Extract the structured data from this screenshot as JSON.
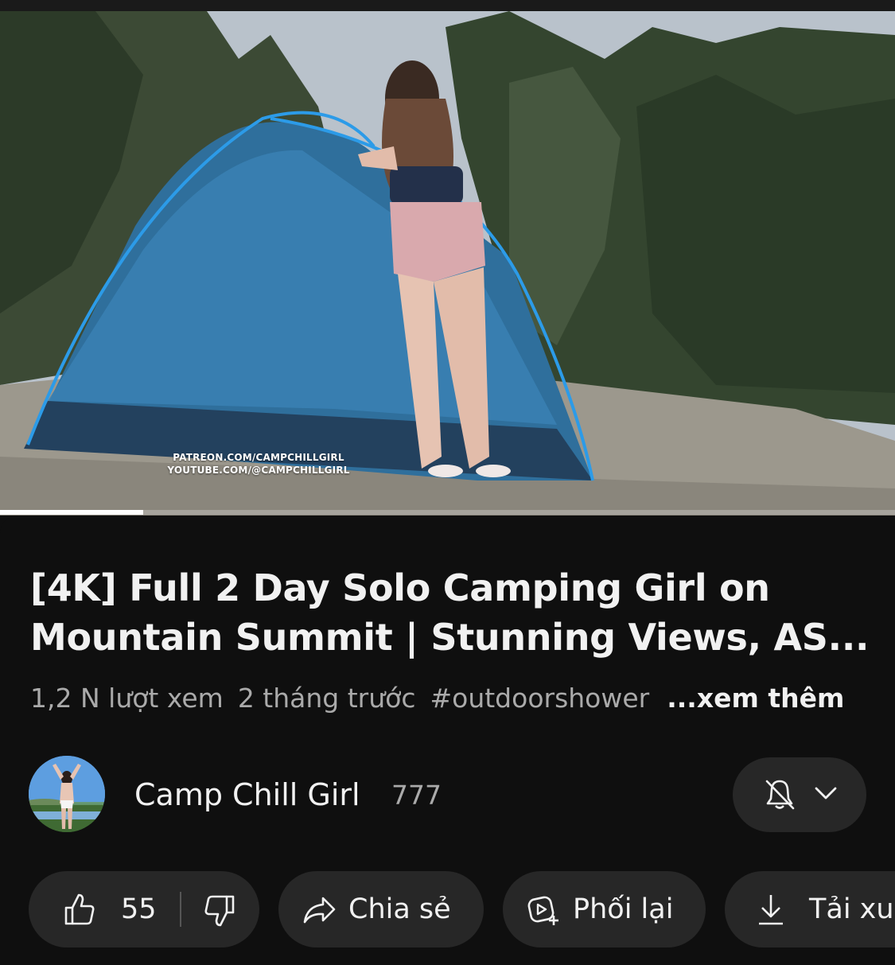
{
  "video": {
    "watermark_line1": "PATREON.COM/CAMPCHILLGIRL",
    "watermark_line2": "YOUTUBE.COM/@CAMPCHILLGIRL",
    "progress_fraction": 0.16
  },
  "title": "[4K] Full 2 Day Solo Camping Girl on Mountain Summit | Stunning Views, AS...",
  "meta": {
    "views": "1,2 N lượt xem",
    "age": "2 tháng trước",
    "hashtag": "#outdoorshower",
    "more": "...xem thêm"
  },
  "channel": {
    "name": "Camp Chill Girl",
    "subscribers": "777",
    "notification_icon": "bell-off-icon"
  },
  "actions": {
    "likes": "55",
    "share": "Chia sẻ",
    "remix": "Phối lại",
    "download": "Tải xuống"
  },
  "colors": {
    "background": "#0f0f0f",
    "pill": "#272727",
    "text_primary": "#f1f1f1",
    "text_secondary": "#aaaaaa"
  }
}
